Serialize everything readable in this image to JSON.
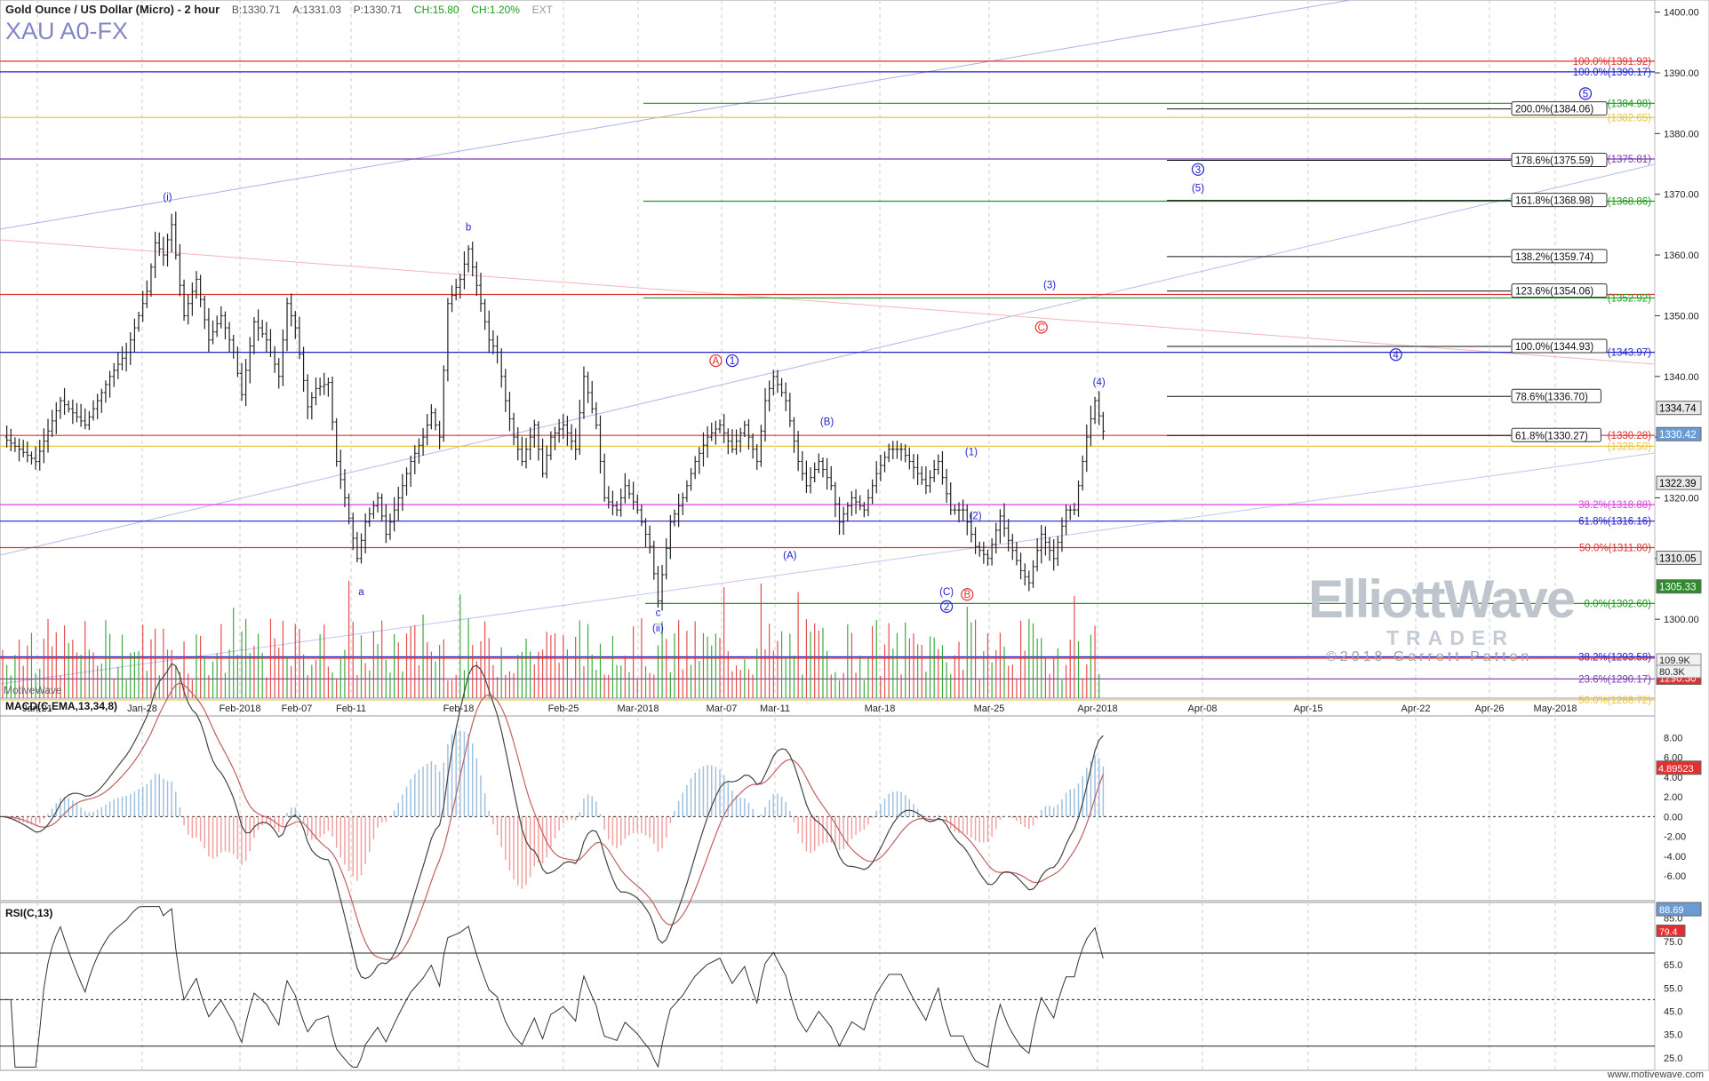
{
  "header": {
    "title": "Gold Ounce / US Dollar (Micro) - 2 hour",
    "bid": "B:1330.71",
    "ask": "A:1331.03",
    "price": "P:1330.71",
    "change": "CH:15.80",
    "change_pct": "CH:1.20%",
    "ext": "EXT",
    "symbol": "XAU A0-FX"
  },
  "watermark": {
    "brand_main": "ElliottWave",
    "brand_sub": "TRADER",
    "copyright": "©2018 Garrett Patten",
    "platform": "MotiveWave",
    "site": "www.motivewave.com"
  },
  "panels": {
    "macd_label": "MACD(C,EMA,13,34,8)",
    "rsi_label": "RSI(C,13)"
  },
  "colors": {
    "up": "#1a9d1a",
    "down": "#e03030",
    "red": "#e03030",
    "blue": "#2222cc",
    "green": "#1a9d1a",
    "yellow": "#e8c440",
    "magenta": "#e040e0",
    "purple": "#7a3aaa",
    "macd_pos": "#9fc1e0",
    "macd_neg": "#f3a0a0"
  },
  "chart_data": {
    "type": "ohlc",
    "price_range": [
      1287,
      1402
    ],
    "x_ticks": [
      "Jan-21",
      "Jan-28",
      "Feb-2018",
      "Feb-07",
      "Feb-11",
      "Feb-18",
      "Feb-25",
      "Mar-2018",
      "Mar-07",
      "Mar-11",
      "Mar-18",
      "Mar-25",
      "Apr-2018",
      "Apr-08",
      "Apr-15",
      "Apr-22",
      "Apr-26",
      "May-2018"
    ],
    "y_ticks": [
      1300,
      1310,
      1320,
      1330,
      1340,
      1350,
      1360,
      1370,
      1380,
      1390,
      1400
    ],
    "y_tick_labels": [
      "1300.00",
      "1310.00",
      "1320.00",
      "1330.00",
      "1340.00",
      "1350.00",
      "1360.00",
      "1370.00",
      "1380.00",
      "1390.00",
      "1400.00"
    ],
    "price_path": [
      [
        0,
        1330
      ],
      [
        8,
        1326
      ],
      [
        14,
        1336
      ],
      [
        20,
        1332
      ],
      [
        26,
        1340
      ],
      [
        30,
        1344
      ],
      [
        35,
        1354
      ],
      [
        37,
        1362
      ],
      [
        39,
        1360
      ],
      [
        41,
        1365
      ],
      [
        44,
        1350
      ],
      [
        47,
        1356
      ],
      [
        50,
        1346
      ],
      [
        53,
        1350
      ],
      [
        56,
        1344
      ],
      [
        58,
        1337
      ],
      [
        61,
        1349
      ],
      [
        64,
        1346
      ],
      [
        67,
        1340
      ],
      [
        69,
        1352
      ],
      [
        71,
        1348
      ],
      [
        74,
        1335
      ],
      [
        76,
        1338
      ],
      [
        79,
        1339
      ],
      [
        81,
        1326
      ],
      [
        83,
        1320
      ],
      [
        86,
        1310
      ],
      [
        88,
        1316
      ],
      [
        91,
        1320
      ],
      [
        93,
        1314
      ],
      [
        96,
        1320
      ],
      [
        99,
        1326
      ],
      [
        102,
        1330
      ],
      [
        104,
        1334
      ],
      [
        106,
        1330
      ],
      [
        108,
        1352
      ],
      [
        111,
        1356
      ],
      [
        113,
        1361
      ],
      [
        116,
        1352
      ],
      [
        118,
        1346
      ],
      [
        120,
        1344
      ],
      [
        122,
        1336
      ],
      [
        124,
        1330
      ],
      [
        126,
        1326
      ],
      [
        129,
        1332
      ],
      [
        131,
        1324
      ],
      [
        133,
        1330
      ],
      [
        136,
        1332
      ],
      [
        139,
        1328
      ],
      [
        141,
        1340
      ],
      [
        144,
        1332
      ],
      [
        146,
        1320
      ],
      [
        149,
        1318
      ],
      [
        151,
        1322
      ],
      [
        154,
        1318
      ],
      [
        157,
        1312
      ],
      [
        159,
        1303
      ],
      [
        162,
        1316
      ],
      [
        165,
        1320
      ],
      [
        168,
        1326
      ],
      [
        171,
        1330
      ],
      [
        174,
        1332
      ],
      [
        177,
        1328
      ],
      [
        180,
        1332
      ],
      [
        183,
        1326
      ],
      [
        185,
        1336
      ],
      [
        187,
        1340
      ],
      [
        190,
        1336
      ],
      [
        193,
        1326
      ],
      [
        195,
        1322
      ],
      [
        198,
        1326
      ],
      [
        201,
        1322
      ],
      [
        203,
        1316
      ],
      [
        206,
        1320
      ],
      [
        209,
        1318
      ],
      [
        212,
        1324
      ],
      [
        215,
        1328
      ],
      [
        218,
        1328
      ],
      [
        221,
        1325
      ],
      [
        224,
        1322
      ],
      [
        227,
        1326
      ],
      [
        230,
        1318
      ],
      [
        233,
        1318
      ],
      [
        236,
        1312
      ],
      [
        239,
        1310
      ],
      [
        242,
        1317
      ],
      [
        244,
        1313
      ],
      [
        247,
        1308
      ],
      [
        249,
        1306
      ],
      [
        252,
        1314
      ],
      [
        255,
        1310
      ],
      [
        258,
        1318
      ],
      [
        260,
        1318
      ],
      [
        263,
        1330
      ],
      [
        265,
        1336
      ],
      [
        267,
        1331
      ]
    ],
    "x_range": [
      0,
      395
    ],
    "volume_range": [
      0,
      60000
    ],
    "volume_labels": [
      "109.9K",
      "80.3K",
      "0"
    ],
    "price_badges": [
      {
        "value": 1334.74,
        "label": "1334.74",
        "bg": "#e8e8e8",
        "fg": "#000"
      },
      {
        "value": 1330.42,
        "label": "1330.42",
        "bg": "#6b9bd2",
        "fg": "#fff"
      },
      {
        "value": 1322.39,
        "label": "1322.39",
        "bg": "#e8e8e8",
        "fg": "#000"
      },
      {
        "value": 1310.05,
        "label": "1310.05",
        "bg": "#e8e8e8",
        "fg": "#000"
      },
      {
        "value": 1305.33,
        "label": "1305.33",
        "bg": "#2e8b2e",
        "fg": "#fff"
      },
      {
        "value": 1290.3,
        "label": "1290.30",
        "bg": "#e03030",
        "fg": "#fff"
      }
    ],
    "full_lines": [
      {
        "value": 1391.92,
        "color": "#e03030",
        "label": "100.0%(1391.92)"
      },
      {
        "value": 1390.17,
        "color": "#2222cc",
        "label": "100.0%(1390.17)"
      },
      {
        "value": 1382.65,
        "color": "#e8c440",
        "label": "(1382.65)"
      },
      {
        "value": 1375.81,
        "color": "#7a3aaa",
        "label": "(1375.81)"
      },
      {
        "value": 1353.5,
        "color": "#e03030",
        "label": ""
      },
      {
        "value": 1343.97,
        "color": "#2222cc",
        "label": "(1343.97)"
      },
      {
        "value": 1330.28,
        "color": "#e03030",
        "label": "(1330.28)"
      },
      {
        "value": 1328.5,
        "color": "#e8c440",
        "label": "(1328.50)"
      },
      {
        "value": 1318.88,
        "color": "#e040e0",
        "label": "38.2%(1318.88)"
      },
      {
        "value": 1316.16,
        "color": "#2222cc",
        "label": "61.8%(1316.16)"
      },
      {
        "value": 1311.8,
        "color": "#e03030",
        "label": "50.0%(1311.80)"
      },
      {
        "value": 1293.8,
        "color": "#2222cc",
        "label": "38.2%(1293.58)"
      },
      {
        "value": 1293.58,
        "color": "#e03030",
        "label": ""
      },
      {
        "value": 1290.17,
        "color": "#7a3aaa",
        "label": "23.6%(1290.17)"
      },
      {
        "value": 1286.72,
        "color": "#e8c440",
        "label": "50.0%(1286.72)"
      }
    ],
    "partial_lines": [
      {
        "value": 1384.98,
        "color": "#1a9d1a",
        "from": "x",
        "label": "(1384.98)"
      },
      {
        "value": 1368.86,
        "color": "#1a9d1a",
        "from": "x",
        "label": "(1368.86)"
      },
      {
        "value": 1352.92,
        "color": "#1a9d1a",
        "from": "x",
        "label": "(1352.92)"
      },
      {
        "value": 1302.6,
        "color": "#1a9d1a",
        "from": "x",
        "label": "0.0%(1302.60)"
      }
    ],
    "fib_boxes": [
      {
        "value": 1384.06,
        "label": "200.0%(1384.06)"
      },
      {
        "value": 1375.59,
        "label": "178.6%(1375.59)"
      },
      {
        "value": 1368.98,
        "label": "161.8%(1368.98)"
      },
      {
        "value": 1359.74,
        "label": "138.2%(1359.74)"
      },
      {
        "value": 1354.06,
        "label": "123.6%(1354.06)"
      },
      {
        "value": 1344.93,
        "label": "100.0%(1344.93)"
      },
      {
        "value": 1336.7,
        "label": "78.6%(1336.70)"
      },
      {
        "value": 1330.27,
        "label": "61.8%(1330.27)"
      }
    ],
    "wave_labels": [
      {
        "t": "(i)",
        "x": 40,
        "p": 1369,
        "c": "#2222cc"
      },
      {
        "t": "b",
        "x": 113,
        "p": 1364,
        "c": "#2222cc"
      },
      {
        "t": "a",
        "x": 87,
        "p": 1304,
        "c": "#2222cc"
      },
      {
        "t": "c",
        "x": 159,
        "p": 1300.5,
        "c": "#2222cc"
      },
      {
        "t": "(ii)",
        "x": 159,
        "p": 1298,
        "c": "#2222cc"
      },
      {
        "t": "A",
        "x": 173,
        "p": 1342,
        "c": "#e03030",
        "circle": true
      },
      {
        "t": "1",
        "x": 177,
        "p": 1342,
        "c": "#2222cc",
        "circle": true
      },
      {
        "t": "(B)",
        "x": 200,
        "p": 1332,
        "c": "#2222cc"
      },
      {
        "t": "(A)",
        "x": 191,
        "p": 1310,
        "c": "#2222cc"
      },
      {
        "t": "(C)",
        "x": 229,
        "p": 1304,
        "c": "#2222cc"
      },
      {
        "t": "2",
        "x": 229,
        "p": 1301.5,
        "c": "#2222cc",
        "circle": true
      },
      {
        "t": "B",
        "x": 234,
        "p": 1303.5,
        "c": "#e03030",
        "circle": true
      },
      {
        "t": "(1)",
        "x": 235,
        "p": 1327,
        "c": "#2222cc"
      },
      {
        "t": "(2)",
        "x": 236,
        "p": 1316.5,
        "c": "#2222cc"
      },
      {
        "t": "(3)",
        "x": 254,
        "p": 1354.5,
        "c": "#2222cc"
      },
      {
        "t": "C",
        "x": 252,
        "p": 1347.5,
        "c": "#e03030",
        "circle": true
      },
      {
        "t": "(4)",
        "x": 266,
        "p": 1338.5,
        "c": "#2222cc"
      },
      {
        "t": "3",
        "x": 290,
        "p": 1373.5,
        "c": "#2222cc",
        "circle": true
      },
      {
        "t": "(5)",
        "x": 290,
        "p": 1370.5,
        "c": "#2222cc"
      },
      {
        "t": "4",
        "x": 338,
        "p": 1343,
        "c": "#2222cc",
        "circle": true
      },
      {
        "t": "5",
        "x": 384,
        "p": 1386,
        "c": "#2222cc",
        "circle": true
      }
    ],
    "macd": {
      "y_ticks": [
        8,
        6,
        4,
        2,
        0,
        -2,
        -4,
        -6
      ],
      "y_tick_labels": [
        "8.00",
        "6.00",
        "4.00",
        "2.00",
        "0.00",
        "-2.00",
        "-4.00",
        "-6.00"
      ],
      "current": "4.89523",
      "range": [
        -8.5,
        10
      ]
    },
    "rsi": {
      "y_ticks": [
        85,
        75,
        65,
        55,
        45,
        35,
        25
      ],
      "y_tick_labels": [
        "85.0",
        "75.0",
        "65.0",
        "55.0",
        "45.0",
        "35.0",
        "25.0"
      ],
      "current": "88.69",
      "current2": "79.4",
      "range": [
        20,
        91
      ]
    }
  }
}
